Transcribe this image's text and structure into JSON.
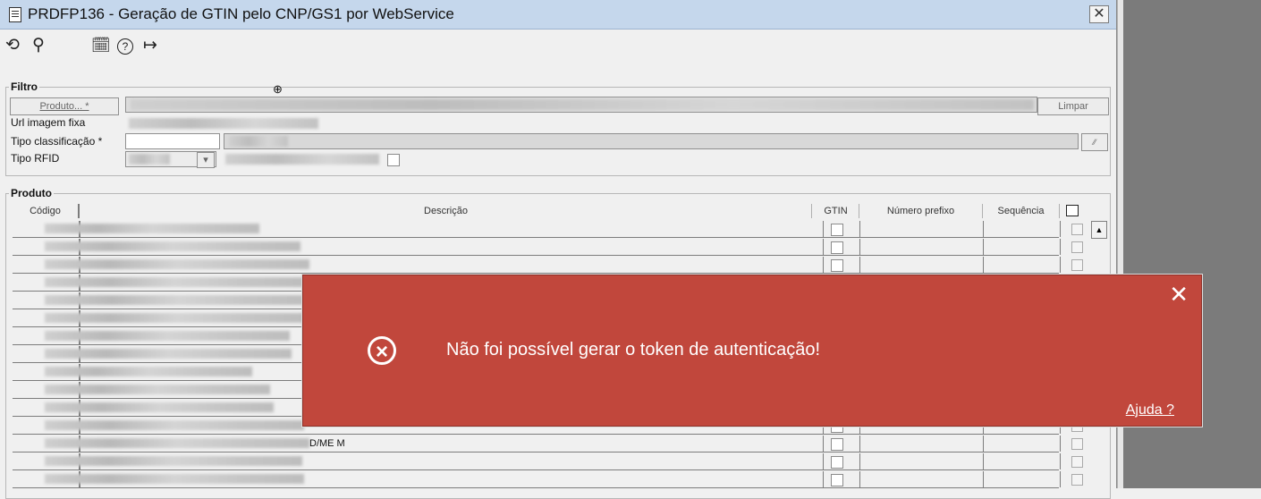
{
  "window": {
    "title": "PRDFP136 - Geração de GTIN pelo CNP/GS1 por WebService",
    "close_label": "✕"
  },
  "toolbar": {
    "icons": [
      "undo-icon",
      "search-icon",
      "calendar-icon",
      "help-icon",
      "exit-icon"
    ],
    "glyphs": [
      "⟲",
      "⚲",
      "🗓",
      "?",
      "↦"
    ]
  },
  "filter": {
    "group_label": "Filtro",
    "product_button": "Produto... *",
    "clear_button": "Limpar",
    "url_label": "Url imagem fixa",
    "tipo_class_label": "Tipo classificação *",
    "tipo_rfid_label": "Tipo RFID"
  },
  "product": {
    "group_label": "Produto",
    "columns": [
      "Código",
      "Descrição",
      "GTIN",
      "Número prefixo",
      "Sequência"
    ],
    "rows": [
      {
        "desc_tail": ""
      },
      {
        "desc_tail": ""
      },
      {
        "desc_tail": ""
      },
      {
        "desc_tail": ""
      },
      {
        "desc_tail": ""
      },
      {
        "desc_tail": ""
      },
      {
        "desc_tail": ""
      },
      {
        "desc_tail": ""
      },
      {
        "desc_tail": ""
      },
      {
        "desc_tail": ""
      },
      {
        "desc_tail": ""
      },
      {
        "desc_tail": ""
      },
      {
        "desc_tail": "D/ME M"
      },
      {
        "desc_tail": ""
      },
      {
        "desc_tail": ""
      }
    ]
  },
  "toast": {
    "message": "Não foi possível gerar o token de autenticação!",
    "help_link": "Ajuda ?",
    "close": "✕",
    "color": "#c1473c"
  }
}
